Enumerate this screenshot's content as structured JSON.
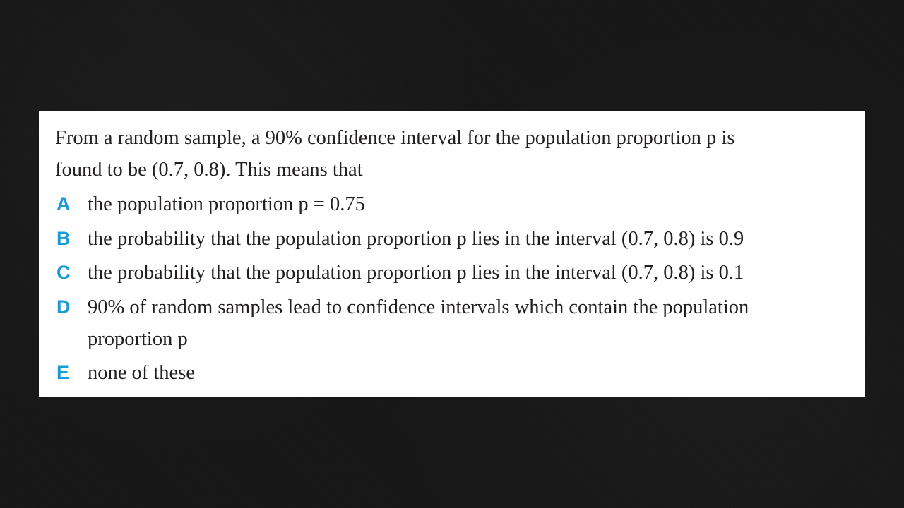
{
  "question": {
    "stem_line1": "From a random sample, a 90% confidence interval for the population proportion p is",
    "stem_line2": "found to be (0.7, 0.8). This means that"
  },
  "options": [
    {
      "letter": "A",
      "line1": "the population proportion p = 0.75"
    },
    {
      "letter": "B",
      "line1": "the probability that the population proportion p lies in the interval (0.7, 0.8) is 0.9"
    },
    {
      "letter": "C",
      "line1": "the probability that the population proportion p lies in the interval (0.7, 0.8) is 0.1"
    },
    {
      "letter": "D",
      "line1": "90% of random samples lead to confidence intervals which contain the population",
      "line2": "proportion p"
    },
    {
      "letter": "E",
      "line1": "none of these"
    }
  ],
  "colors": {
    "letter_accent": "#1a9ad6",
    "text": "#231f20",
    "card_bg": "#ffffff",
    "page_bg": "#161616"
  }
}
